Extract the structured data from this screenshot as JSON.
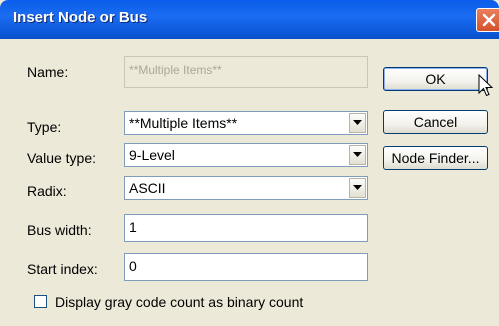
{
  "window": {
    "title": "Insert Node or Bus"
  },
  "form": {
    "name_label": "Name:",
    "name_value": "**Multiple Items**",
    "type_label": "Type:",
    "type_value": "**Multiple Items**",
    "value_type_label": "Value type:",
    "value_type_value": "9-Level",
    "radix_label": "Radix:",
    "radix_value": "ASCII",
    "bus_width_label": "Bus width:",
    "bus_width_value": "1",
    "start_index_label": "Start index:",
    "start_index_value": "0",
    "gray_code_label": "Display gray code count as binary count",
    "gray_code_checked": false
  },
  "buttons": {
    "ok": "OK",
    "cancel": "Cancel",
    "node_finder": "Node Finder..."
  }
}
